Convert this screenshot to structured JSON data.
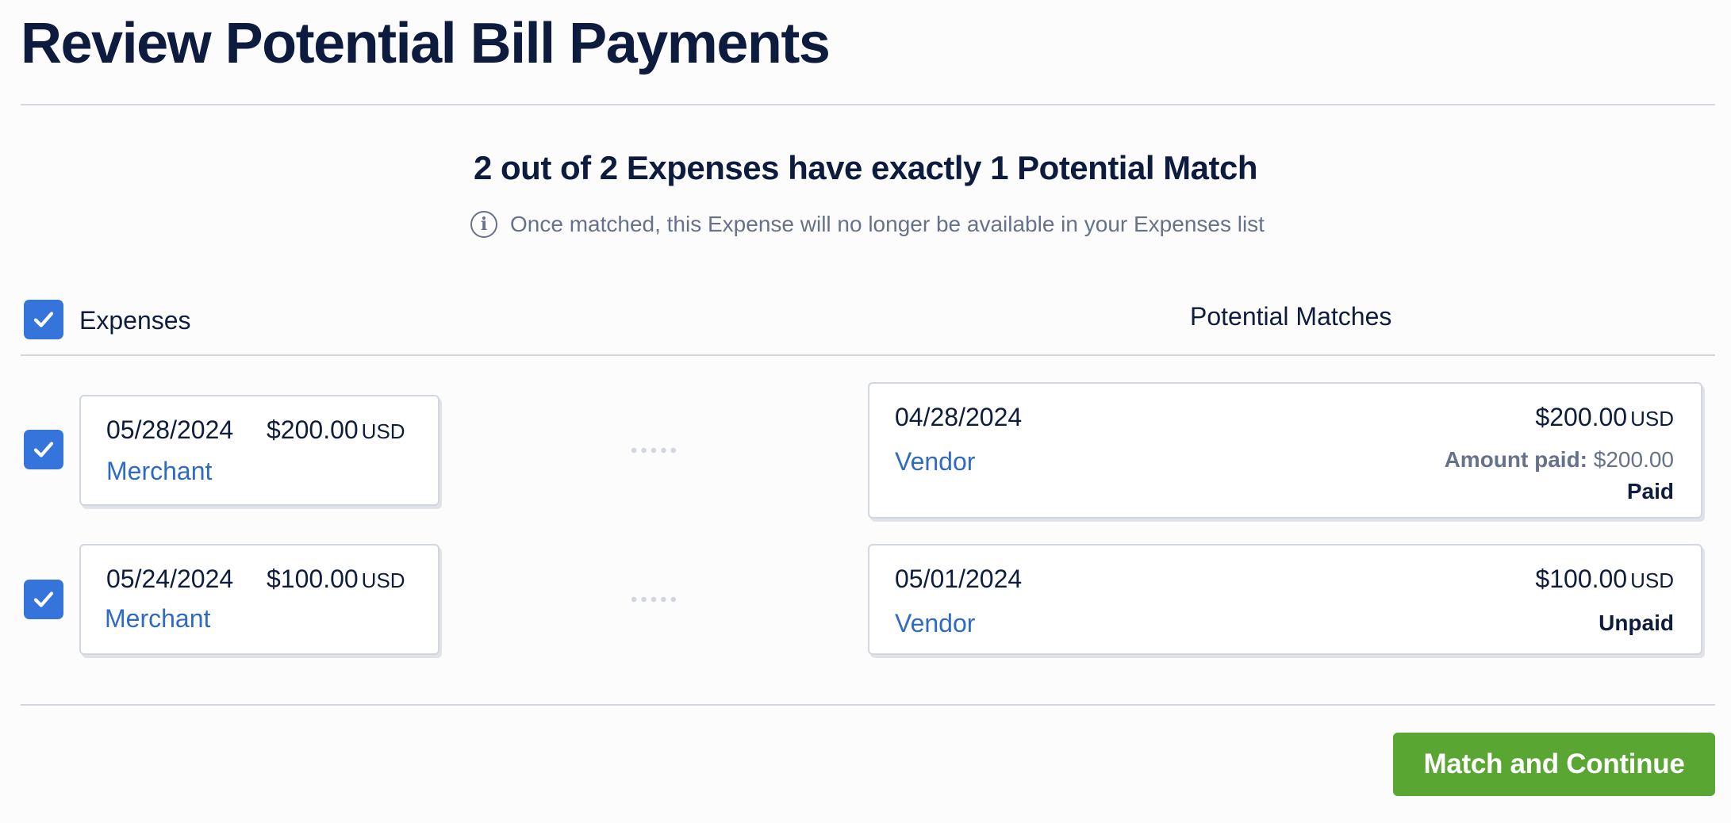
{
  "page": {
    "title": "Review Potential Bill Payments",
    "summary": "2 out of 2 Expenses have exactly 1 Potential Match",
    "notice": "Once matched, this Expense will no longer be available in your Expenses list"
  },
  "columns": {
    "expenses_label": "Expenses",
    "matches_label": "Potential Matches"
  },
  "rows": [
    {
      "expense": {
        "date": "05/28/2024",
        "amount": "$200.00",
        "currency": "USD",
        "party": "Merchant",
        "checked": true
      },
      "match": {
        "date": "04/28/2024",
        "amount": "$200.00",
        "currency": "USD",
        "party": "Vendor",
        "amount_paid_label": "Amount paid:",
        "amount_paid_value": "$200.00",
        "status": "Paid"
      }
    },
    {
      "expense": {
        "date": "05/24/2024",
        "amount": "$100.00",
        "currency": "USD",
        "party": "Merchant",
        "checked": true
      },
      "match": {
        "date": "05/01/2024",
        "amount": "$100.00",
        "currency": "USD",
        "party": "Vendor",
        "status": "Unpaid"
      }
    }
  ],
  "actions": {
    "primary_label": "Match and Continue"
  },
  "icons": {
    "info": "info-circle-icon",
    "check": "checkmark-icon"
  },
  "colors": {
    "accent_blue": "#3574da",
    "link_blue": "#2f6ac4",
    "primary_green": "#5aa633",
    "heading": "#0d1b3e",
    "muted": "#66728a"
  }
}
